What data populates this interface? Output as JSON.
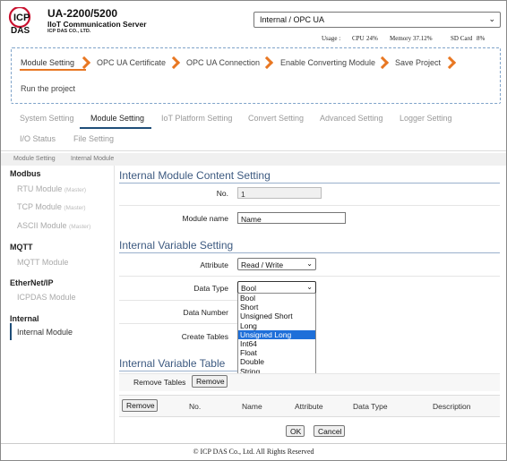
{
  "header": {
    "product_title": "UA-2200/5200",
    "product_subtitle": "IIoT Communication Server",
    "company_small": "ICP DAS CO., LTD.",
    "logo_text_top": "ICP",
    "logo_text_bottom": "DAS",
    "mode_select": "Internal / OPC UA",
    "usage_label": "Usage :",
    "cpu_label": "CPU",
    "cpu_value": "24%",
    "memory_label": "Memory",
    "memory_value": "37.12%",
    "sd_label": "SD Card",
    "sd_value": "8%"
  },
  "wizard": {
    "steps": [
      "Module Setting",
      "OPC UA Certificate",
      "OPC UA Connection",
      "Enable Converting Module",
      "Save Project",
      "Run the project"
    ]
  },
  "tabs": [
    "System Setting",
    "Module Setting",
    "IoT Platform Setting",
    "Convert Setting",
    "Advanced Setting",
    "Logger Setting",
    "I/O Status",
    "File Setting"
  ],
  "breadcrumb": [
    "Module Setting",
    "Internal Module"
  ],
  "sidebar": {
    "groups": [
      {
        "title": "Modbus",
        "items": [
          {
            "label": "RTU Module",
            "note": "(Master)"
          },
          {
            "label": "TCP Module",
            "note": "(Master)"
          },
          {
            "label": "ASCII Module",
            "note": "(Master)"
          }
        ]
      },
      {
        "title": "MQTT",
        "items": [
          {
            "label": "MQTT Module",
            "note": ""
          }
        ]
      },
      {
        "title": "EtherNet/IP",
        "items": [
          {
            "label": "ICPDAS Module",
            "note": ""
          }
        ]
      },
      {
        "title": "Internal",
        "items": [
          {
            "label": "Internal Module",
            "note": ""
          }
        ]
      }
    ]
  },
  "content": {
    "section1_title": "Internal Module Content Setting",
    "no_label": "No.",
    "no_value": "1",
    "module_name_label": "Module name",
    "module_name_value": "Name",
    "section2_title": "Internal Variable Setting",
    "attribute_label": "Attribute",
    "attribute_value": "Read / Write",
    "data_type_label": "Data Type",
    "data_type_value": "Bool",
    "data_number_label": "Data Number",
    "create_tables_label": "Create Tables",
    "data_type_options": [
      "Bool",
      "Short",
      "Unsigned Short",
      "Long",
      "Unsigned Long",
      "Int64",
      "Float",
      "Double",
      "String"
    ],
    "highlighted_option": "Unsigned Long",
    "section3_title": "Internal Variable Table",
    "remove_tables_label": "Remove Tables",
    "remove_button": "Remove",
    "table_remove_button": "Remove",
    "columns": [
      "No.",
      "Name",
      "Attribute",
      "Data Type",
      "Description"
    ],
    "ok_button": "OK",
    "cancel_button": "Cancel"
  },
  "footer": "© ICP DAS Co., Ltd. All Rights Reserved",
  "colors": {
    "accent_orange": "#e87722",
    "accent_blue": "#1f4e79",
    "logo_red": "#c8102e",
    "highlight": "#1e6fd9"
  }
}
